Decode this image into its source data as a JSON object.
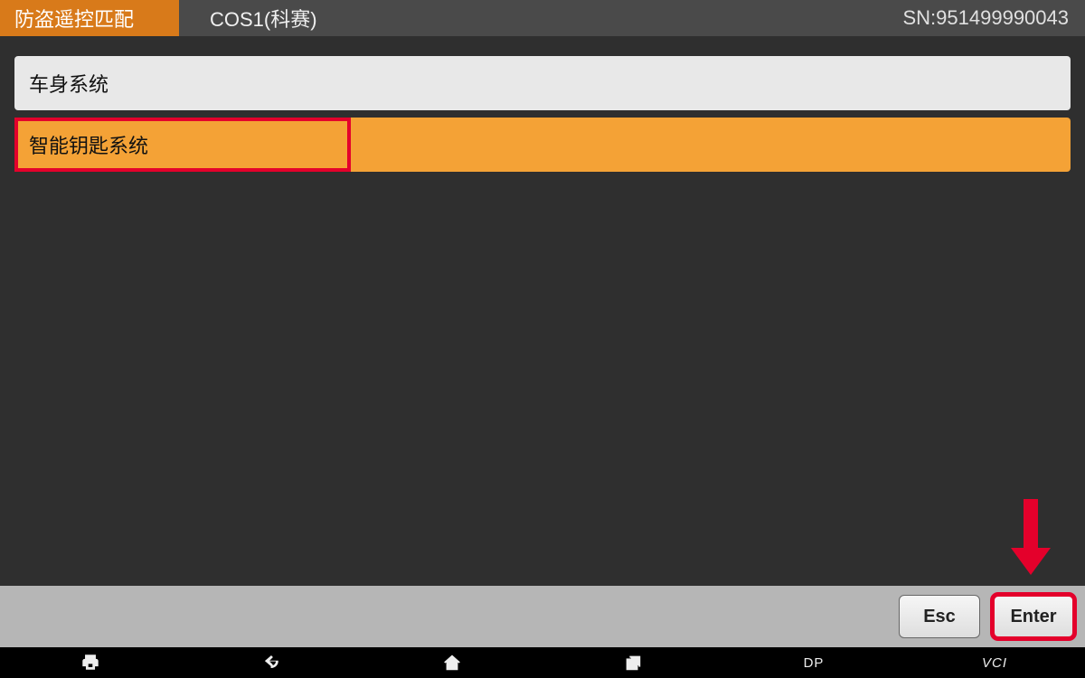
{
  "header": {
    "tab_label": "防盗遥控匹配",
    "model": "COS1(科赛)",
    "sn": "SN:951499990043"
  },
  "menu": {
    "items": [
      {
        "label": "车身系统",
        "selected": false,
        "highlighted": false
      },
      {
        "label": "智能钥匙系统",
        "selected": true,
        "highlighted": true
      }
    ]
  },
  "toolbar": {
    "esc_label": "Esc",
    "enter_label": "Enter"
  },
  "navbar": {
    "dp_label": "DP",
    "vci_label": "VCI"
  }
}
